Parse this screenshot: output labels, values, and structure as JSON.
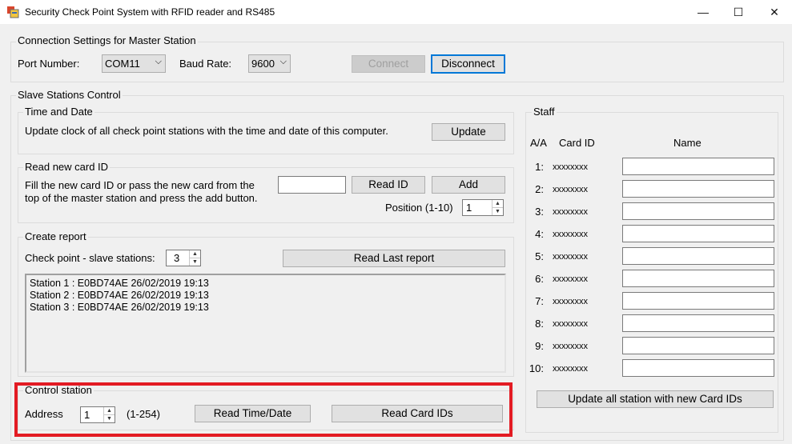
{
  "window": {
    "title": "Security Check Point System with RFID reader and RS485",
    "minimize": "—",
    "maximize": "☐",
    "close": "✕"
  },
  "connection": {
    "group_label": "Connection Settings for Master Station",
    "port_label": "Port Number:",
    "port_value": "COM11",
    "baud_label": "Baud Rate:",
    "baud_value": "9600",
    "connect_label": "Connect",
    "disconnect_label": "Disconnect"
  },
  "slave": {
    "group_label": "Slave Stations Control",
    "time": {
      "group_label": "Time and Date",
      "desc": "Update clock of all check point stations with the time and date of this computer.",
      "update_label": "Update"
    },
    "readcard": {
      "group_label": "Read new card ID",
      "desc_line1": "Fill the new card ID or pass the new card from the",
      "desc_line2": "top of the master station and press the add button.",
      "card_value": "",
      "read_id_label": "Read ID",
      "add_label": "Add",
      "position_label": "Position (1-10)",
      "position_value": "1"
    },
    "report": {
      "group_label": "Create report",
      "checkpoint_label": "Check point - slave stations:",
      "checkpoint_value": "3",
      "read_last_label": "Read Last report",
      "lines": [
        "Station 1 : E0BD74AE 26/02/2019 19:13",
        "Station 2 : E0BD74AE 26/02/2019 19:13",
        "Station 3 : E0BD74AE 26/02/2019 19:13"
      ]
    },
    "control": {
      "group_label": "Control station",
      "address_label": "Address",
      "address_value": "1",
      "range_label": "(1-254)",
      "read_time_label": "Read Time/Date",
      "read_cards_label": "Read Card IDs"
    },
    "staff": {
      "group_label": "Staff",
      "col_aa": "A/A",
      "col_card": "Card ID",
      "col_name": "Name",
      "rows": [
        {
          "num": "1:",
          "card": "xxxxxxxx",
          "name": ""
        },
        {
          "num": "2:",
          "card": "xxxxxxxx",
          "name": ""
        },
        {
          "num": "3:",
          "card": "xxxxxxxx",
          "name": ""
        },
        {
          "num": "4:",
          "card": "xxxxxxxx",
          "name": ""
        },
        {
          "num": "5:",
          "card": "xxxxxxxx",
          "name": ""
        },
        {
          "num": "6:",
          "card": "xxxxxxxx",
          "name": ""
        },
        {
          "num": "7:",
          "card": "xxxxxxxx",
          "name": ""
        },
        {
          "num": "8:",
          "card": "xxxxxxxx",
          "name": ""
        },
        {
          "num": "9:",
          "card": "xxxxxxxx",
          "name": ""
        },
        {
          "num": "10:",
          "card": "xxxxxxxx",
          "name": ""
        }
      ],
      "update_all_label": "Update all station with new Card IDs"
    }
  },
  "colors": {
    "highlight": "#e31b23",
    "focus": "#0078d7",
    "background": "#f0f0f0"
  }
}
